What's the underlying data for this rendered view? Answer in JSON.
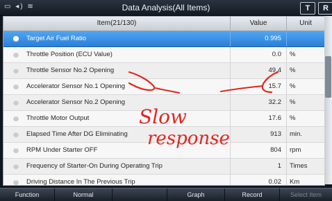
{
  "title_bar": {
    "status_icons": "▭ ◂) ≋",
    "title": "Data Analysis(All Items)",
    "btn_t": "T",
    "btn_r": "R"
  },
  "table": {
    "headers": {
      "item": "Item(21/130)",
      "value": "Value",
      "unit": "Unit"
    },
    "rows": [
      {
        "name": "Target Air Fuel Ratio",
        "value": "0.995",
        "unit": "",
        "selected": true
      },
      {
        "name": "Throttle Position (ECU Value)",
        "value": "0.0",
        "unit": "%"
      },
      {
        "name": "Throttle Sensor No.2 Opening",
        "value": "49.4",
        "unit": "%"
      },
      {
        "name": "Accelerator Sensor No.1 Opening",
        "value": "15.7",
        "unit": "%"
      },
      {
        "name": "Accelerator Sensor No.2 Opening",
        "value": "32.2",
        "unit": "%"
      },
      {
        "name": "Throttle Motor Output",
        "value": "17.6",
        "unit": "%"
      },
      {
        "name": "Elapsed Time After DG Eliminating",
        "value": "913",
        "unit": "min."
      },
      {
        "name": "RPM Under Starter OFF",
        "value": "804",
        "unit": "rpm"
      },
      {
        "name": "Frequency of Starter-On During Operating Trip",
        "value": "1",
        "unit": "Times"
      },
      {
        "name": "Driving Distance In The Previous Trip",
        "value": "0.02",
        "unit": "Km"
      }
    ]
  },
  "toolbar": {
    "function": "Function",
    "normal": "Normal",
    "graph": "Graph",
    "record": "Record",
    "select_item": "Select Item"
  },
  "annotation": {
    "line1": "Slow",
    "line2": "response",
    "color": "#e0271f"
  },
  "colors": {
    "selected_row": "#2b7fd6",
    "title_bar": "#1f2731"
  }
}
